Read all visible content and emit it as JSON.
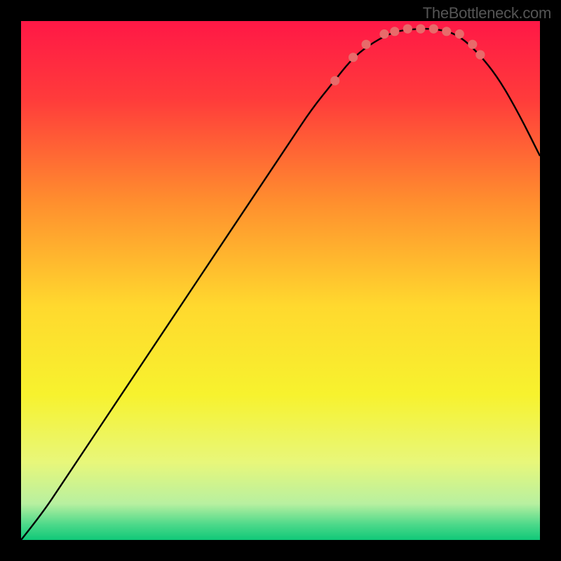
{
  "watermark": "TheBottleneck.com",
  "chart_data": {
    "type": "line",
    "title": "",
    "xlabel": "",
    "ylabel": "",
    "xlim": [
      0,
      1
    ],
    "ylim": [
      0,
      1
    ],
    "grid": false,
    "background": {
      "type": "vertical-gradient",
      "stops": [
        {
          "pos": 0.0,
          "color": "#ff1846"
        },
        {
          "pos": 0.15,
          "color": "#ff3b3b"
        },
        {
          "pos": 0.35,
          "color": "#ff8f2e"
        },
        {
          "pos": 0.55,
          "color": "#ffd92e"
        },
        {
          "pos": 0.72,
          "color": "#f7f22e"
        },
        {
          "pos": 0.85,
          "color": "#e8f77a"
        },
        {
          "pos": 0.93,
          "color": "#b8f0a0"
        },
        {
          "pos": 0.97,
          "color": "#4dd98a"
        },
        {
          "pos": 1.0,
          "color": "#10c878"
        }
      ]
    },
    "series": [
      {
        "name": "bottleneck-curve",
        "type": "line",
        "color": "#000000",
        "points": [
          {
            "x": 0.0,
            "y": 0.0
          },
          {
            "x": 0.04,
            "y": 0.05
          },
          {
            "x": 0.08,
            "y": 0.11
          },
          {
            "x": 0.12,
            "y": 0.17
          },
          {
            "x": 0.16,
            "y": 0.23
          },
          {
            "x": 0.2,
            "y": 0.29
          },
          {
            "x": 0.24,
            "y": 0.35
          },
          {
            "x": 0.28,
            "y": 0.41
          },
          {
            "x": 0.32,
            "y": 0.47
          },
          {
            "x": 0.36,
            "y": 0.53
          },
          {
            "x": 0.4,
            "y": 0.59
          },
          {
            "x": 0.44,
            "y": 0.65
          },
          {
            "x": 0.48,
            "y": 0.71
          },
          {
            "x": 0.52,
            "y": 0.77
          },
          {
            "x": 0.56,
            "y": 0.83
          },
          {
            "x": 0.6,
            "y": 0.88
          },
          {
            "x": 0.64,
            "y": 0.93
          },
          {
            "x": 0.68,
            "y": 0.96
          },
          {
            "x": 0.72,
            "y": 0.98
          },
          {
            "x": 0.76,
            "y": 0.985
          },
          {
            "x": 0.8,
            "y": 0.985
          },
          {
            "x": 0.84,
            "y": 0.975
          },
          {
            "x": 0.88,
            "y": 0.94
          },
          {
            "x": 0.92,
            "y": 0.89
          },
          {
            "x": 0.96,
            "y": 0.82
          },
          {
            "x": 1.0,
            "y": 0.74
          }
        ]
      },
      {
        "name": "highlight-dots",
        "type": "scatter",
        "color": "#e86a6a",
        "points": [
          {
            "x": 0.605,
            "y": 0.885
          },
          {
            "x": 0.64,
            "y": 0.93
          },
          {
            "x": 0.665,
            "y": 0.955
          },
          {
            "x": 0.7,
            "y": 0.975
          },
          {
            "x": 0.72,
            "y": 0.98
          },
          {
            "x": 0.745,
            "y": 0.985
          },
          {
            "x": 0.77,
            "y": 0.985
          },
          {
            "x": 0.795,
            "y": 0.985
          },
          {
            "x": 0.82,
            "y": 0.98
          },
          {
            "x": 0.845,
            "y": 0.975
          },
          {
            "x": 0.87,
            "y": 0.955
          },
          {
            "x": 0.885,
            "y": 0.935
          }
        ]
      }
    ]
  }
}
